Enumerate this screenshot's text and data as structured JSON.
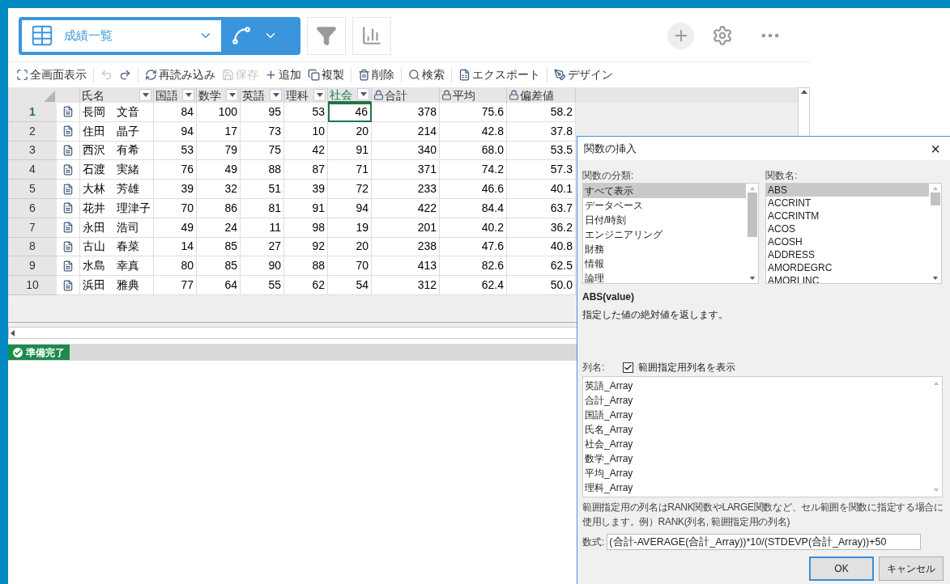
{
  "view_selector": {
    "value": "成績一覧"
  },
  "toolbar": [
    {
      "kind": "fullscreen",
      "label": "全画面表示",
      "disabled": false
    },
    {
      "kind": "undo",
      "disabled": true
    },
    {
      "kind": "redo",
      "disabled": false
    },
    {
      "kind": "reload",
      "label": "再読み込み",
      "disabled": false
    },
    {
      "kind": "save",
      "label": "保存",
      "disabled": true
    },
    {
      "kind": "add",
      "label": "追加",
      "disabled": false
    },
    {
      "kind": "copy",
      "label": "複製",
      "disabled": false
    },
    {
      "kind": "delete",
      "label": "削除",
      "disabled": false
    },
    {
      "kind": "search",
      "label": "検索",
      "disabled": false
    },
    {
      "kind": "export",
      "label": "エクスポート",
      "disabled": false
    },
    {
      "kind": "design",
      "label": "デザイン",
      "disabled": false
    }
  ],
  "table": {
    "columns": [
      {
        "label": "氏名",
        "kind": "filter",
        "selected": false
      },
      {
        "label": "国語",
        "kind": "filter",
        "selected": false
      },
      {
        "label": "数学",
        "kind": "filter",
        "selected": false
      },
      {
        "label": "英語",
        "kind": "filter",
        "selected": false
      },
      {
        "label": "理科",
        "kind": "filter",
        "selected": false
      },
      {
        "label": "社会",
        "kind": "filter",
        "selected": true
      },
      {
        "label": "合計",
        "kind": "locked",
        "selected": false
      },
      {
        "label": "平均",
        "kind": "locked",
        "selected": false
      },
      {
        "label": "偏差値",
        "kind": "locked",
        "selected": false
      }
    ],
    "rows": [
      {
        "number": "1",
        "selected": true,
        "cells": [
          "長岡　文音",
          "84",
          "100",
          "95",
          "53",
          "46",
          "378",
          "75.6",
          "58.2"
        ]
      },
      {
        "number": "2",
        "selected": false,
        "cells": [
          "住田　晶子",
          "94",
          "17",
          "73",
          "10",
          "20",
          "214",
          "42.8",
          "37.8"
        ]
      },
      {
        "number": "3",
        "selected": false,
        "cells": [
          "西沢　有希",
          "53",
          "79",
          "75",
          "42",
          "91",
          "340",
          "68.0",
          "53.5"
        ]
      },
      {
        "number": "4",
        "selected": false,
        "cells": [
          "石渡　実緒",
          "76",
          "49",
          "88",
          "87",
          "71",
          "371",
          "74.2",
          "57.3"
        ]
      },
      {
        "number": "5",
        "selected": false,
        "cells": [
          "大林　芳雄",
          "39",
          "32",
          "51",
          "39",
          "72",
          "233",
          "46.6",
          "40.1"
        ]
      },
      {
        "number": "6",
        "selected": false,
        "cells": [
          "花井　理津子",
          "70",
          "86",
          "81",
          "91",
          "94",
          "422",
          "84.4",
          "63.7"
        ]
      },
      {
        "number": "7",
        "selected": false,
        "cells": [
          "永田　浩司",
          "49",
          "24",
          "11",
          "98",
          "19",
          "201",
          "40.2",
          "36.2"
        ]
      },
      {
        "number": "8",
        "selected": false,
        "cells": [
          "古山　春菜",
          "14",
          "85",
          "27",
          "92",
          "20",
          "238",
          "47.6",
          "40.8"
        ]
      },
      {
        "number": "9",
        "selected": false,
        "cells": [
          "水島　幸真",
          "80",
          "85",
          "90",
          "88",
          "70",
          "413",
          "82.6",
          "62.5"
        ]
      },
      {
        "number": "10",
        "selected": false,
        "cells": [
          "浜田　雅典",
          "77",
          "64",
          "55",
          "62",
          "54",
          "312",
          "62.4",
          "50.0"
        ]
      }
    ]
  },
  "status_bar": {
    "text": "準備完了"
  },
  "dialog": {
    "title": "関数の挿入",
    "close": "×",
    "category_label": "関数の分類:",
    "categories": [
      {
        "label": "すべて表示",
        "selected": true
      },
      {
        "label": "データベース",
        "selected": false
      },
      {
        "label": "日付/時刻",
        "selected": false
      },
      {
        "label": "エンジニアリング",
        "selected": false
      },
      {
        "label": "財務",
        "selected": false
      },
      {
        "label": "情報",
        "selected": false
      },
      {
        "label": "論理",
        "selected": false
      }
    ],
    "function_label": "関数名:",
    "functions": [
      {
        "label": "ABS",
        "selected": true
      },
      {
        "label": "ACCRINT",
        "selected": false
      },
      {
        "label": "ACCRINTM",
        "selected": false
      },
      {
        "label": "ACOS",
        "selected": false
      },
      {
        "label": "ACOSH",
        "selected": false
      },
      {
        "label": "ADDRESS",
        "selected": false
      },
      {
        "label": "AMORDEGRC",
        "selected": false
      },
      {
        "label": "AMORLINC",
        "selected": false
      }
    ],
    "signature": "ABS(value)",
    "description": "指定した値の絶対値を返します。",
    "column_label": "列名:",
    "show_range_names": {
      "label": "範囲指定用列名を表示",
      "checked": true
    },
    "column_names": [
      "英語_Array",
      "合計_Array",
      "国語_Array",
      "氏名_Array",
      "社会_Array",
      "数学_Array",
      "平均_Array",
      "理科_Array"
    ],
    "note": "範囲指定用の列名はRANK関数やLARGE関数など、セル範囲を関数に指定する場合に使用します。例）RANK(列名, 範囲指定用の列名)",
    "formula_label": "数式:",
    "formula": "(合計-AVERAGE(合計_Array))*10/(STDEVP(合計_Array))+50",
    "buttons": [
      {
        "label": "OK",
        "default": true
      },
      {
        "label": "キャンセル",
        "default": false
      }
    ]
  }
}
